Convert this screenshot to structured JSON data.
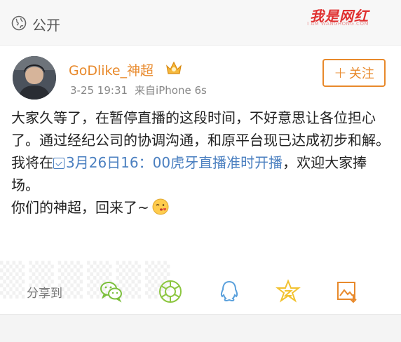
{
  "topbar": {
    "visibility": "公开",
    "watermark": "我是网红",
    "watermark_sub": "I AM WANGHONG.COM"
  },
  "post": {
    "author": "GoDlike_神超",
    "time": "3-25 19:31",
    "source": "来自iPhone 6s",
    "follow_label": "关注",
    "lines": {
      "p1": "大家久等了，在暂停直播的这段时间，不好意思让各位担心了。通过经纪公司的协调沟通，和原平台现已达成初步和解。",
      "p2_prefix": "我将在",
      "p2_link": "3月26日16：00虎牙直播准时开播",
      "p2_suffix": "，欢迎大家捧场。",
      "p3": "你们的神超，回来了~"
    }
  },
  "share": {
    "label": "分享到",
    "targets": [
      "wechat-icon",
      "moments-icon",
      "qq-icon",
      "qzone-icon",
      "save-image-icon"
    ]
  },
  "colors": {
    "accent": "#e8892b",
    "link": "#4a7fc0",
    "share_green": "#7bbf3c",
    "share_blue": "#5aa0dc",
    "share_yellow": "#f2c230"
  }
}
